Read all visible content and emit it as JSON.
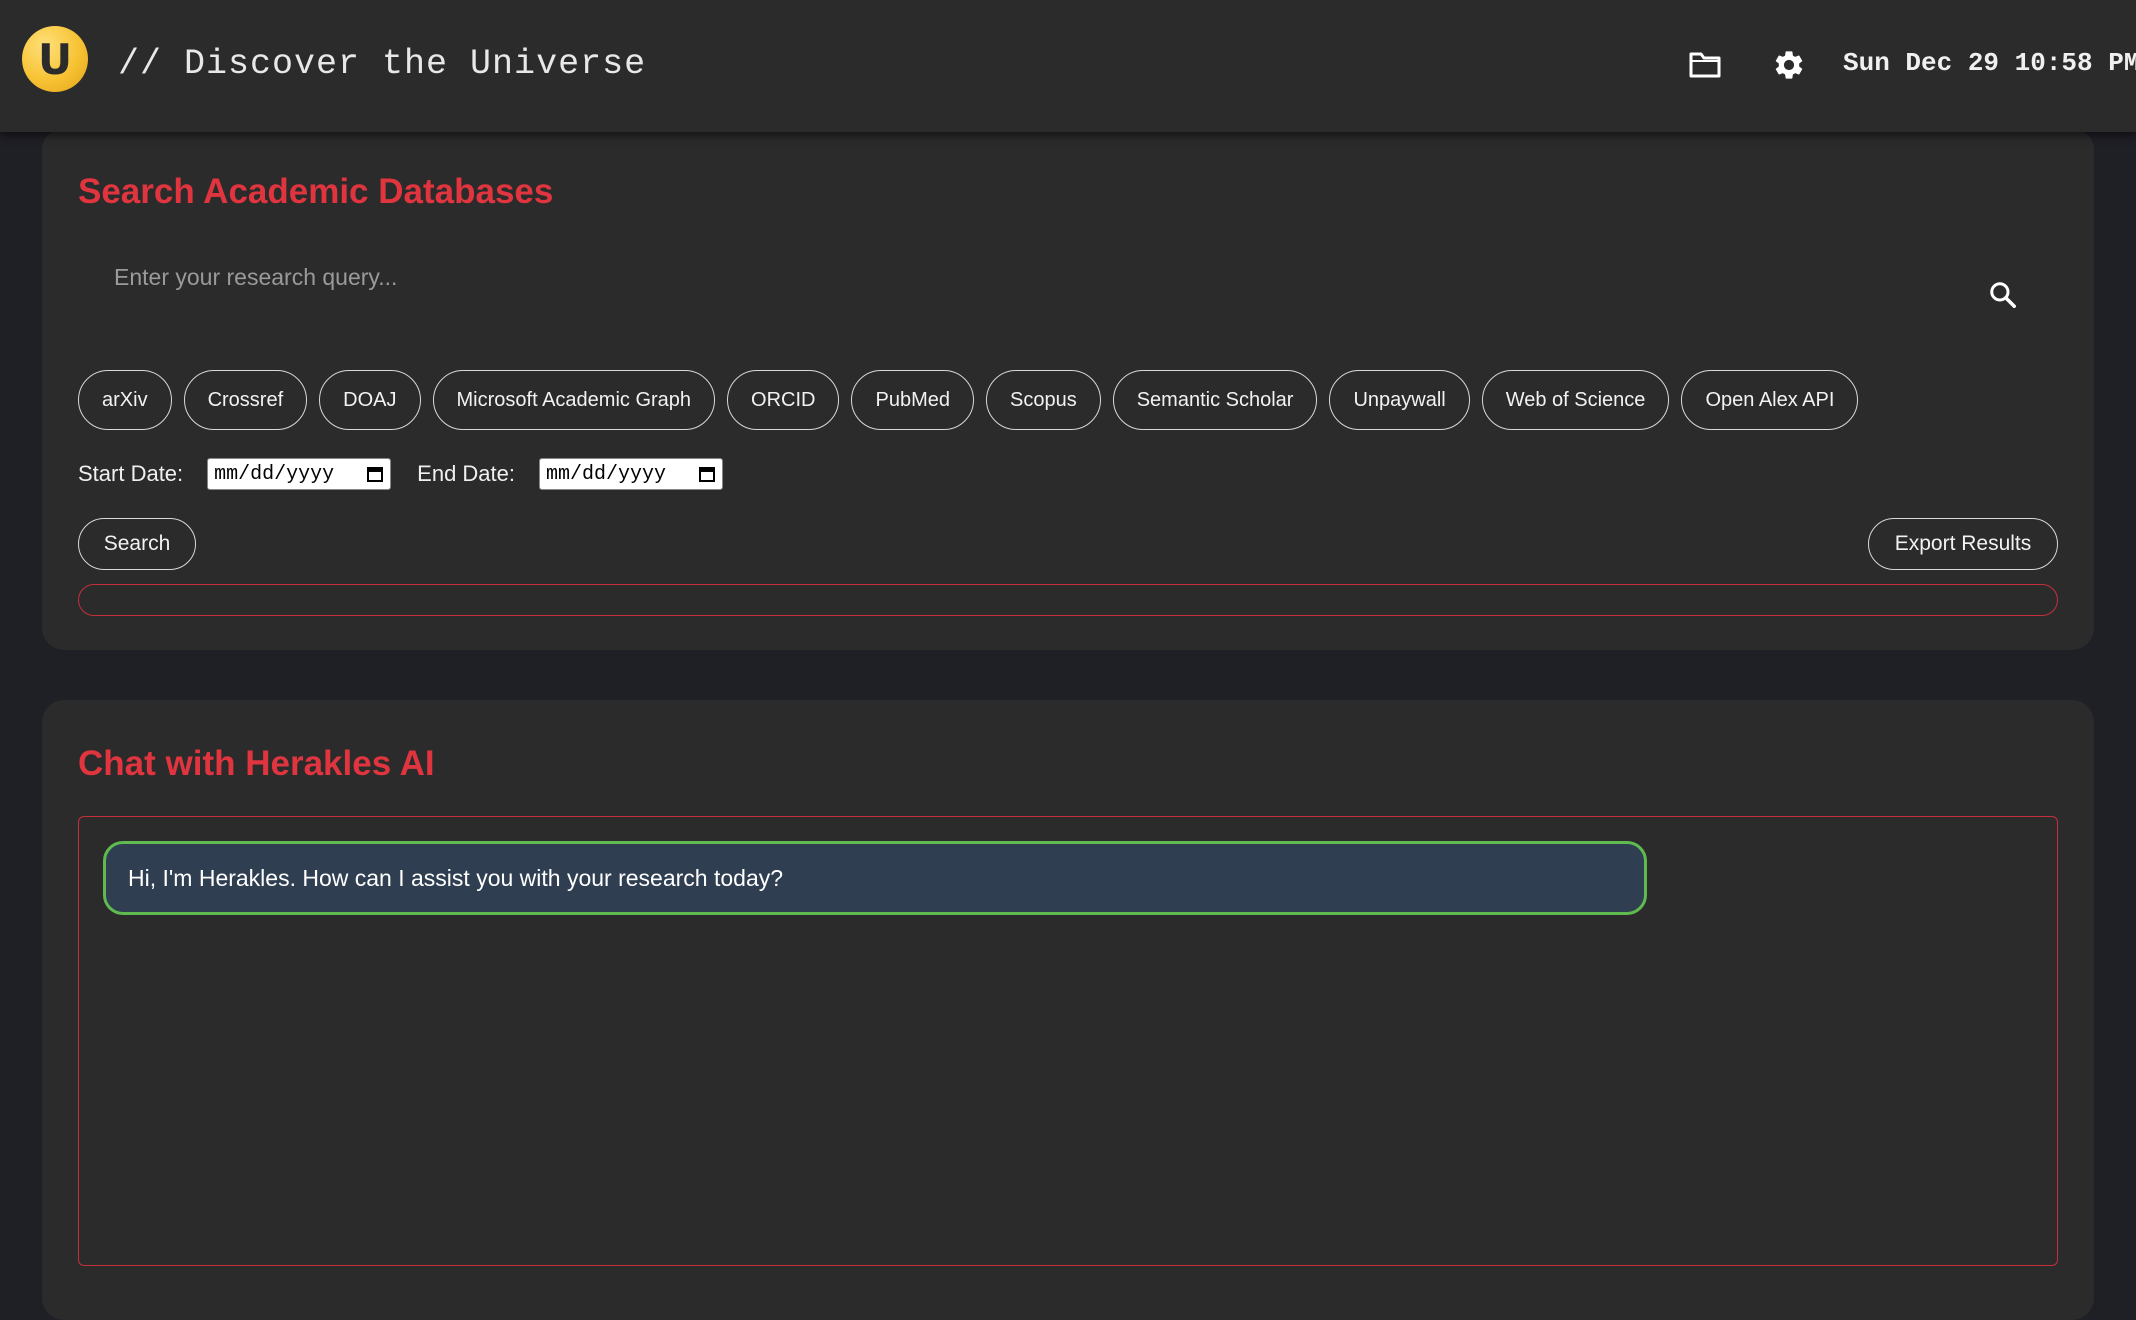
{
  "header": {
    "logo_letter": "U",
    "title": "// Discover the Universe",
    "datetime": "Sun Dec 29 10:58 PM",
    "icons": [
      "folder-icon",
      "gear-icon"
    ]
  },
  "search_panel": {
    "title": "Search Academic Databases",
    "query_placeholder": "Enter your research query...",
    "sources": [
      "arXiv",
      "Crossref",
      "DOAJ",
      "Microsoft Academic Graph",
      "ORCID",
      "PubMed",
      "Scopus",
      "Semantic Scholar",
      "Unpaywall",
      "Web of Science",
      "Open Alex API"
    ],
    "start_date_label": "Start Date:",
    "end_date_label": "End Date:",
    "start_date_placeholder": "mm/dd/yyyy",
    "end_date_placeholder": "mm/dd/yyyy",
    "search_button": "Search",
    "export_button": "Export Results"
  },
  "chat_panel": {
    "title": "Chat with Herakles AI",
    "messages": [
      {
        "sender": "assistant",
        "text": "Hi, I'm Herakles. How can I assist you with your research today?"
      }
    ]
  },
  "colors": {
    "accent_red": "#e0353f",
    "bubble_border": "#5fbb4f",
    "bubble_bg": "#2f3e50",
    "logo_yellow": "#f7c233"
  }
}
